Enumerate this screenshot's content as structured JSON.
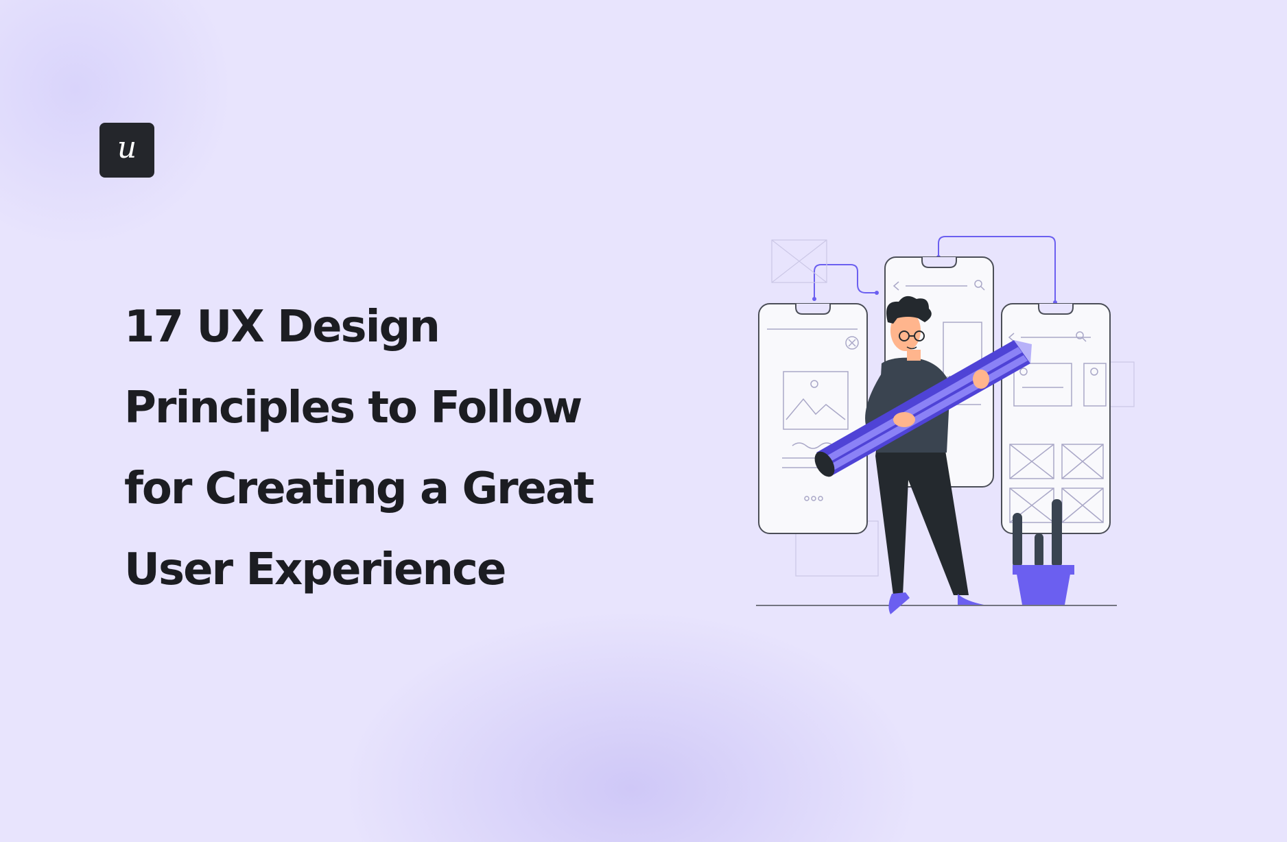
{
  "logo": {
    "letter": "u",
    "background": "#24262b"
  },
  "headline": {
    "lines": [
      "17 UX Design",
      "Principles to Follow",
      "for Creating a Great",
      "User Experience"
    ]
  },
  "illustration": {
    "subject": "person holding a giant pencil in front of mobile wireframes",
    "accent_color": "#6b5ff0"
  }
}
